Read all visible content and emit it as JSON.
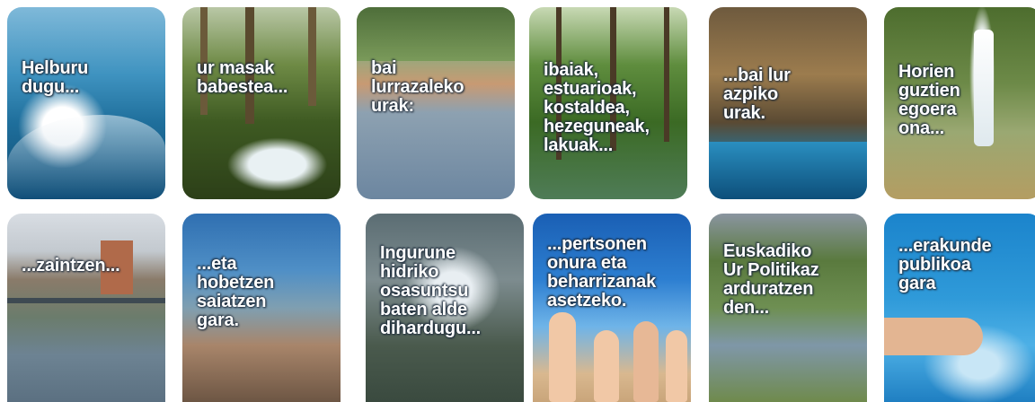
{
  "cards": [
    {
      "caption": "Helburu\ndugu..."
    },
    {
      "caption": "ur masak\nbabestea..."
    },
    {
      "caption": "bai\nlurrazaleko\nurak:"
    },
    {
      "caption": "ibaiak,\nestuarioak,\nkostaldea,\nhezeguneak,\nlakuak..."
    },
    {
      "caption": "...bai lur\nazpiko\nurak."
    },
    {
      "caption": "Horien\nguztien\negoera\nona..."
    },
    {
      "caption": "...zaintzen..."
    },
    {
      "caption": "...eta\nhobetzen\nsaiatzen\ngara."
    },
    {
      "caption": "Ingurune\nhidriko\nosasuntsu\nbaten alde\ndihardugu..."
    },
    {
      "caption": "...pertsonen\nonura eta\nbeharrizanak\n     asetzeko."
    },
    {
      "caption": "Euskadiko\nUr Politikaz\narduratzen\nden..."
    },
    {
      "caption": "...erakunde\npublikoa\ngara"
    }
  ]
}
